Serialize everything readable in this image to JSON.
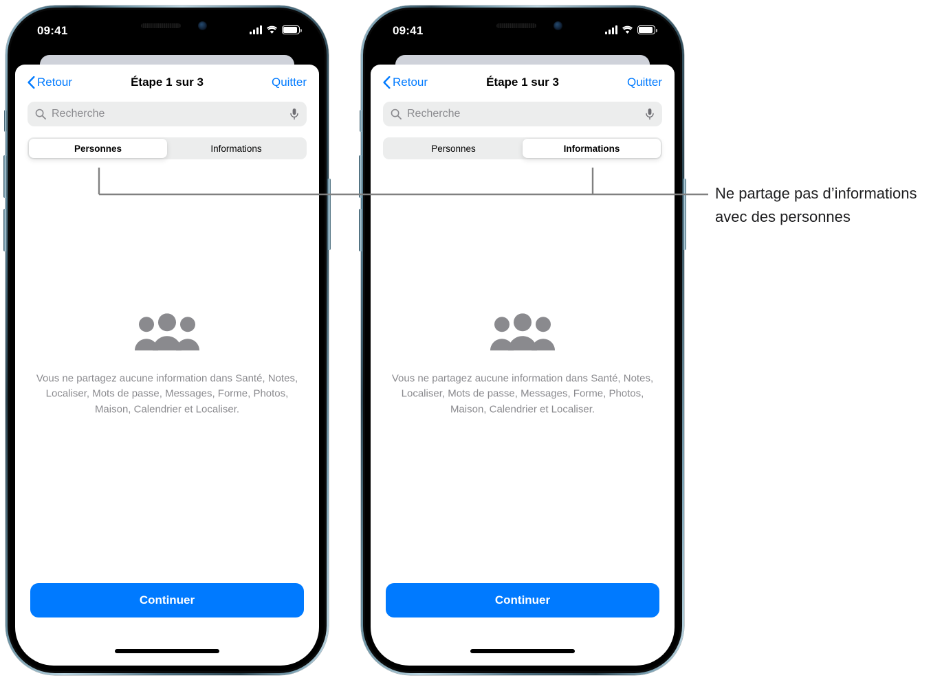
{
  "status_bar": {
    "time": "09:41",
    "icons": [
      "cellular-signal-icon",
      "wifi-icon",
      "battery-icon"
    ]
  },
  "nav": {
    "back_label": "Retour",
    "title": "Étape 1 sur 3",
    "quit_label": "Quitter"
  },
  "search": {
    "placeholder": "Recherche",
    "search_icon": "search-icon",
    "mic_icon": "microphone-icon"
  },
  "segmented": {
    "options": [
      "Personnes",
      "Informations"
    ],
    "selected_left_phone": "Personnes",
    "selected_right_phone": "Informations"
  },
  "empty_state": {
    "icon": "people-group-icon",
    "text": "Vous ne partagez aucune information dans Santé, Notes, Localiser, Mots de passe, Messages, Forme, Photos, Maison, Calendrier et Localiser."
  },
  "footer": {
    "continue_label": "Continuer"
  },
  "callout": {
    "text": "Ne partage pas d’informations avec des personnes"
  },
  "colors": {
    "accent_blue": "#007AFF",
    "secondary_gray": "#8A8A8E",
    "field_gray": "#ECEDED",
    "sheet_back_gray": "#CFD2DA",
    "callout_line": "#808080"
  }
}
